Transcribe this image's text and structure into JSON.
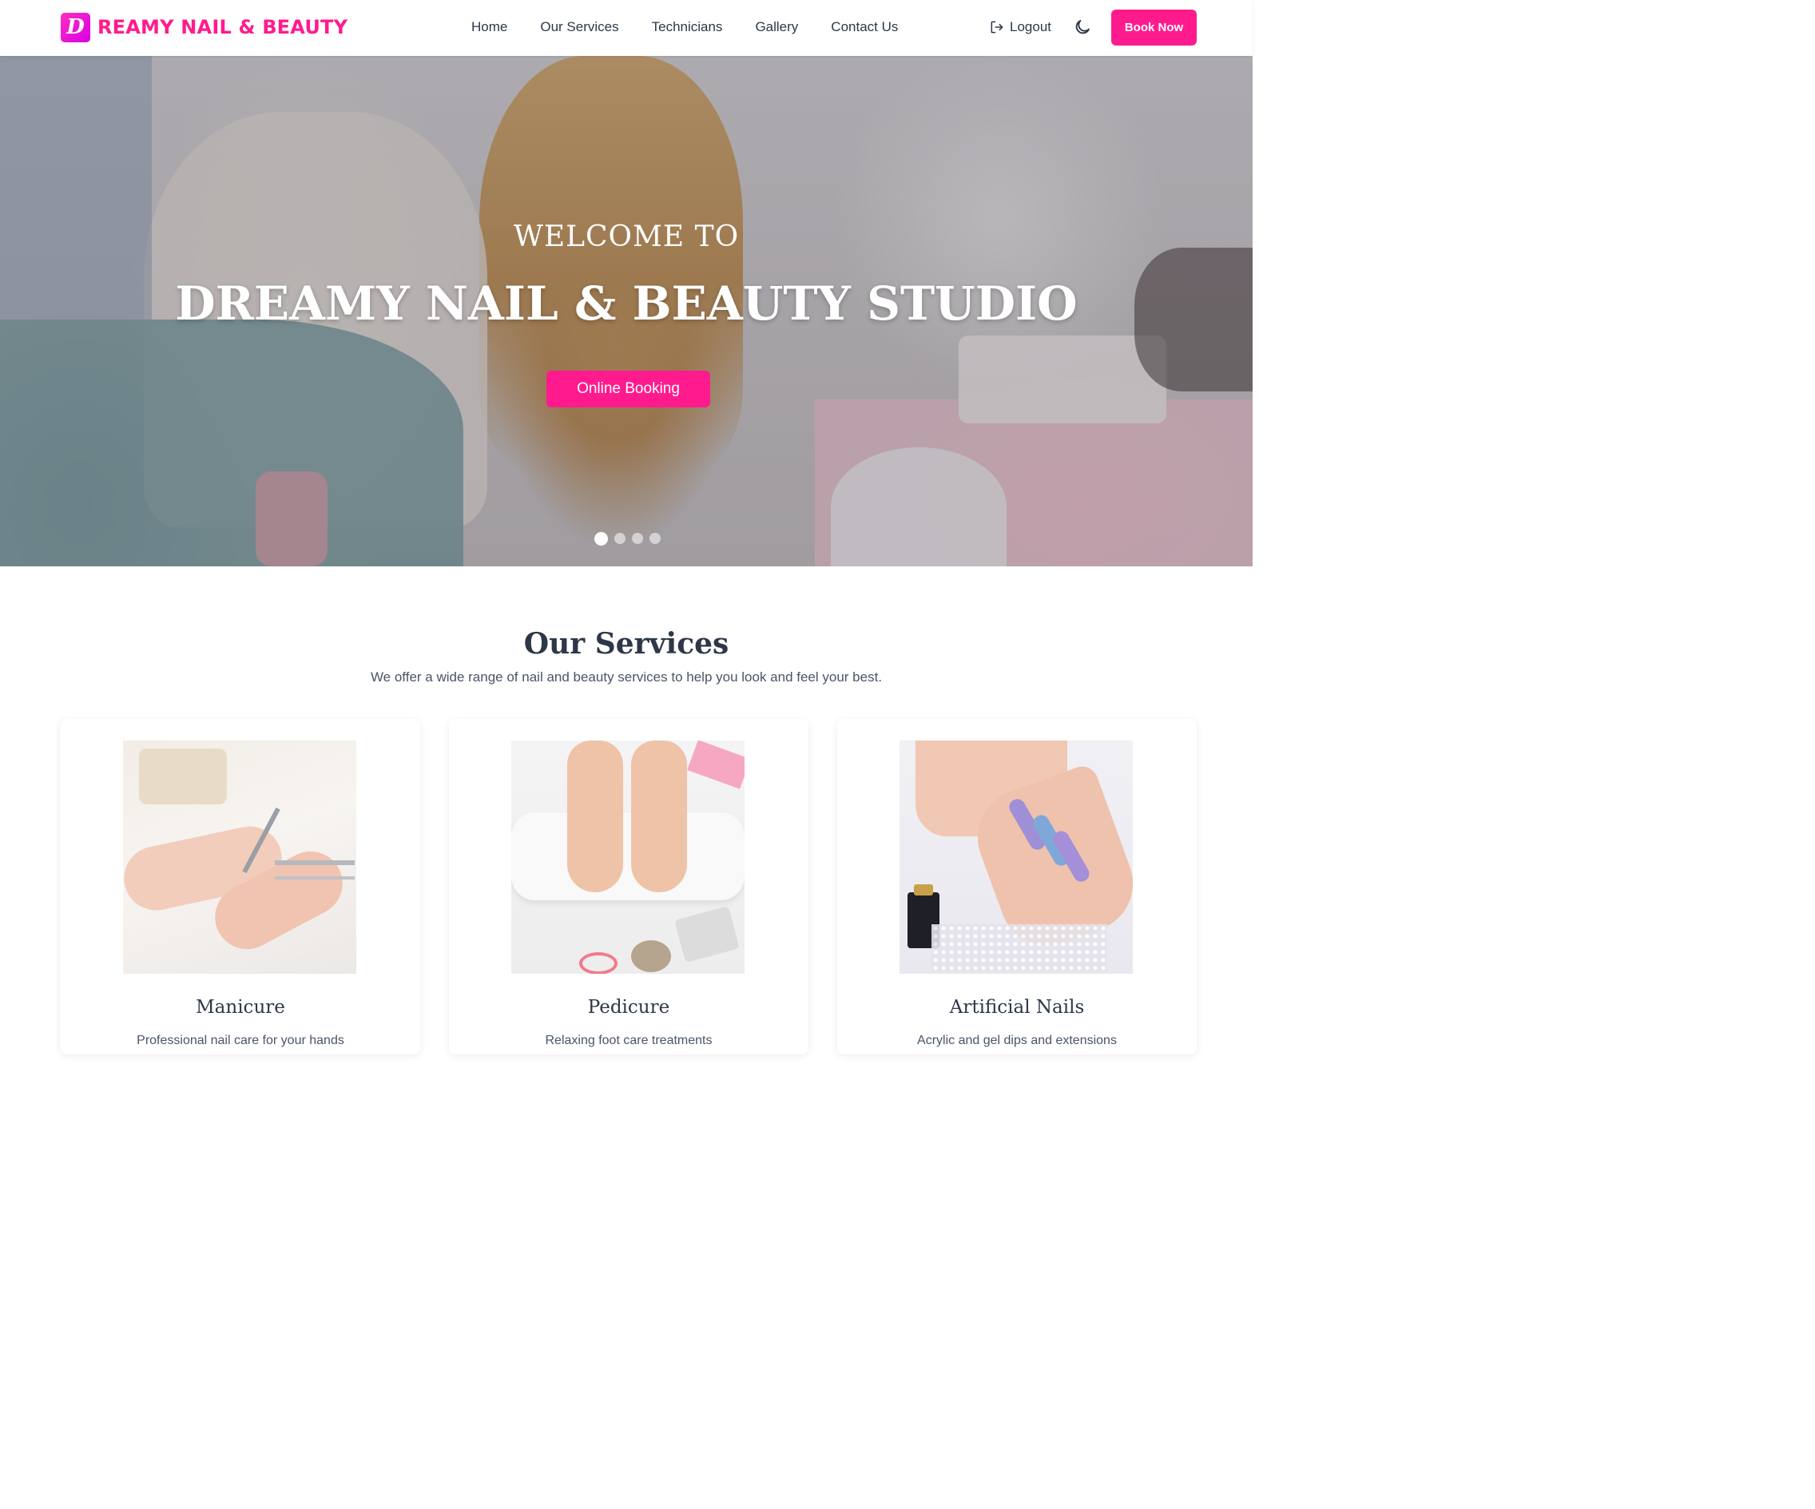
{
  "colors": {
    "accent": "#ff1b8d",
    "text": "#2d3748",
    "logo_gradient": [
      "#ff2fbf",
      "#d600e6"
    ]
  },
  "brand": {
    "logo_letter": "D",
    "name": "REAMY NAIL & BEAUTY"
  },
  "nav": {
    "links": [
      "Home",
      "Our Services",
      "Technicians",
      "Gallery",
      "Contact Us"
    ],
    "logout_label": "Logout",
    "logout_icon": "logout-icon",
    "theme_icon": "moon-icon",
    "book_label": "Book Now"
  },
  "hero": {
    "subtitle": "WELCOME TO",
    "title": "DREAMY NAIL & BEAUTY STUDIO",
    "button_label": "Online Booking",
    "slides_count": 4,
    "active_slide": 1
  },
  "services": {
    "title": "Our Services",
    "subtitle": "We offer a wide range of nail and beauty services to help you look and feel your best.",
    "cards": [
      {
        "title": "Manicure",
        "description": "Professional nail care for your hands"
      },
      {
        "title": "Pedicure",
        "description": "Relaxing foot care treatments"
      },
      {
        "title": "Artificial Nails",
        "description": "Acrylic and gel dips and extensions"
      }
    ]
  }
}
